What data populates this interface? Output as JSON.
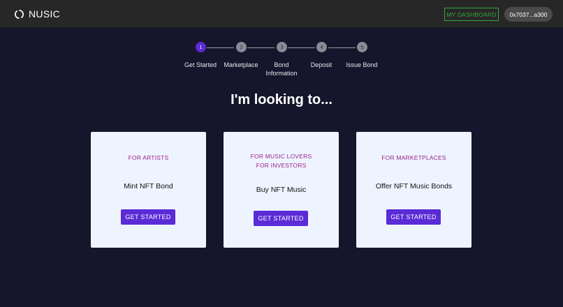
{
  "header": {
    "logo_text": "NUSIC",
    "dashboard_label": "MY DASHBOARD",
    "wallet_label": "0x7037...a300"
  },
  "stepper": {
    "steps": [
      {
        "number": "1",
        "label": "Get Started",
        "active": true
      },
      {
        "number": "2",
        "label": "Marketplace",
        "active": false
      },
      {
        "number": "3",
        "label": "Bond Information",
        "active": false
      },
      {
        "number": "4",
        "label": "Deposit",
        "active": false
      },
      {
        "number": "5",
        "label": "Issue Bond",
        "active": false
      }
    ]
  },
  "main": {
    "heading": "I'm looking to...",
    "cards": [
      {
        "tag_lines": [
          "FOR ARTISTS"
        ],
        "title": "Mint NFT Bond",
        "button": "GET STARTED"
      },
      {
        "tag_lines": [
          "FOR MUSIC LOVERS",
          "FOR INVESTORS"
        ],
        "title": "Buy NFT Music",
        "button": "GET STARTED"
      },
      {
        "tag_lines": [
          "FOR MARKETPLACES"
        ],
        "title": "Offer NFT Music Bonds",
        "button": "GET STARTED"
      }
    ]
  },
  "colors": {
    "background": "#15152b",
    "header": "#272727",
    "accent": "#5a2bd6",
    "tag": "#9c1f8a",
    "dashboard": "#35a83a",
    "card": "#eef4ff"
  }
}
